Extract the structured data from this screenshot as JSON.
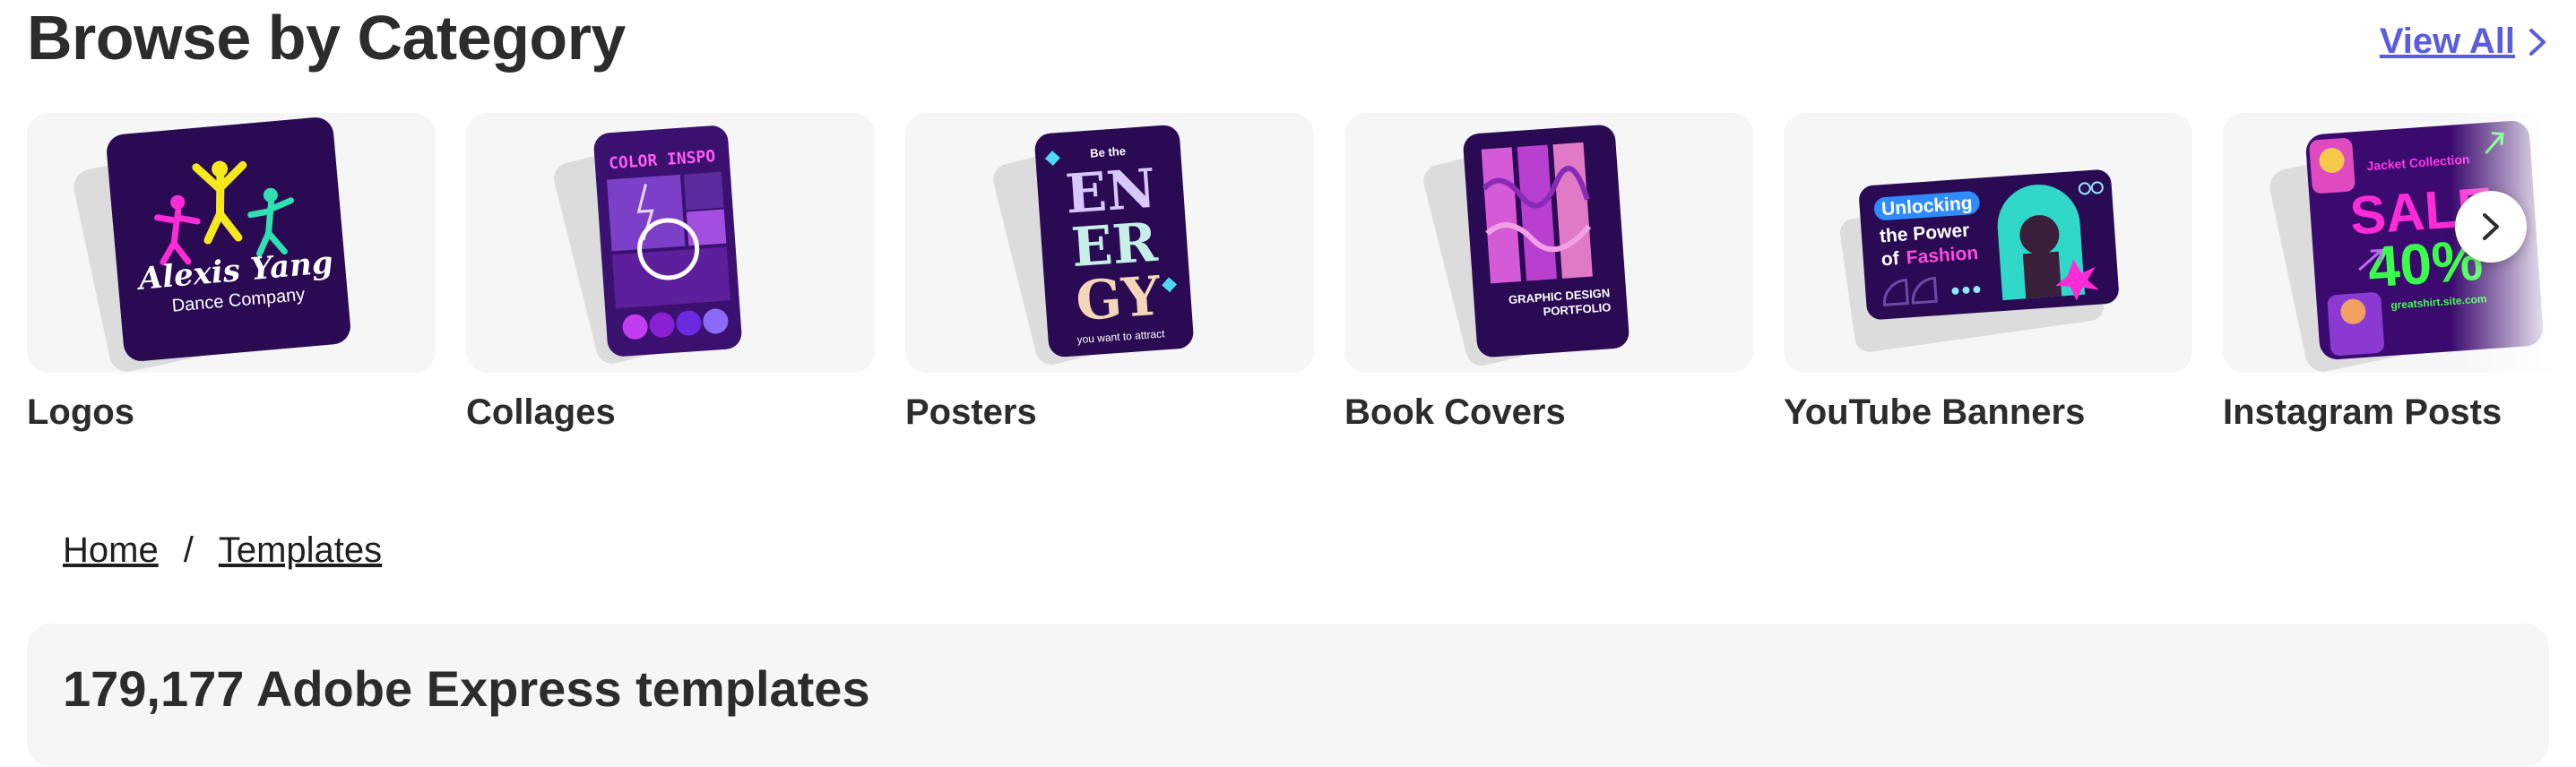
{
  "section": {
    "title": "Browse by Category",
    "view_all_label": "View All"
  },
  "categories": [
    {
      "label": "Logos",
      "thumb_line1": "Alexis Yang",
      "thumb_line2": "Dance Company"
    },
    {
      "label": "Collages",
      "thumb_line1": "COLOR INSPO"
    },
    {
      "label": "Posters",
      "thumb_line1": "Be the",
      "thumb_line2": "EN",
      "thumb_line3": "ER",
      "thumb_line4": "GY",
      "thumb_line5": "you want to attract"
    },
    {
      "label": "Book Covers",
      "thumb_line1": "GRAPHIC DESIGN",
      "thumb_line2": "PORTFOLIO"
    },
    {
      "label": "YouTube Banners",
      "thumb_line1": "Unlocking",
      "thumb_line2": "the Power",
      "thumb_line3": "of",
      "thumb_line4": "Fashion"
    },
    {
      "label": "Instagram Posts",
      "thumb_line1": "SALE",
      "thumb_line2": "40%",
      "thumb_line3": "Jacket Collection",
      "thumb_line4": "greatshirt.site.com"
    }
  ],
  "breadcrumb": {
    "items": [
      "Home",
      "Templates"
    ],
    "separator": "/"
  },
  "results": {
    "title": "179,177 Adobe Express templates"
  },
  "colors": {
    "accent_link": "#5c5ce0",
    "tile_bg": "#f6f6f6",
    "dark_purple": "#2a0a52",
    "neon_pink": "#ff2bd6",
    "neon_green": "#39ff4a"
  },
  "icons": {
    "view_all": "chevron-right-icon",
    "carousel_next": "chevron-right-icon"
  }
}
